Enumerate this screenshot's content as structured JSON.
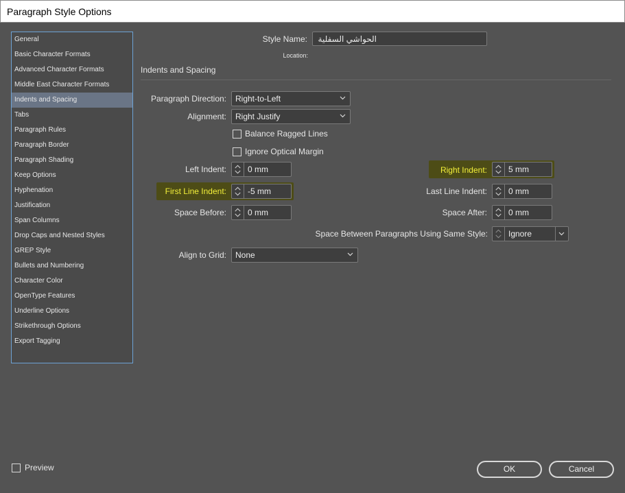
{
  "window": {
    "title": "Paragraph Style Options"
  },
  "sidebar": {
    "items": [
      {
        "label": "General"
      },
      {
        "label": "Basic Character Formats"
      },
      {
        "label": "Advanced Character Formats"
      },
      {
        "label": "Middle East Character Formats"
      },
      {
        "label": "Indents and Spacing",
        "selected": true
      },
      {
        "label": "Tabs"
      },
      {
        "label": "Paragraph Rules"
      },
      {
        "label": "Paragraph Border"
      },
      {
        "label": "Paragraph Shading"
      },
      {
        "label": "Keep Options"
      },
      {
        "label": "Hyphenation"
      },
      {
        "label": "Justification"
      },
      {
        "label": "Span Columns"
      },
      {
        "label": "Drop Caps and Nested Styles"
      },
      {
        "label": "GREP Style"
      },
      {
        "label": "Bullets and Numbering"
      },
      {
        "label": "Character Color"
      },
      {
        "label": "OpenType Features"
      },
      {
        "label": "Underline Options"
      },
      {
        "label": "Strikethrough Options"
      },
      {
        "label": "Export Tagging"
      }
    ]
  },
  "header": {
    "style_name_label": "Style Name:",
    "style_name_value": "الحواشي السفلية",
    "location_label": "Location:"
  },
  "section": {
    "title": "Indents and Spacing"
  },
  "form": {
    "paragraph_direction": {
      "label": "Paragraph Direction:",
      "value": "Right-to-Left"
    },
    "alignment": {
      "label": "Alignment:",
      "value": "Right Justify"
    },
    "balance_ragged_lines": {
      "label": "Balance Ragged Lines",
      "checked": false
    },
    "ignore_optical_margin": {
      "label": "Ignore Optical Margin",
      "checked": false
    },
    "left_indent": {
      "label": "Left Indent:",
      "value": "0 mm"
    },
    "right_indent": {
      "label": "Right Indent:",
      "value": "5 mm"
    },
    "first_line_indent": {
      "label": "First Line Indent:",
      "value": "-5 mm"
    },
    "last_line_indent": {
      "label": "Last Line Indent:",
      "value": "0 mm"
    },
    "space_before": {
      "label": "Space Before:",
      "value": "0 mm"
    },
    "space_after": {
      "label": "Space After:",
      "value": "0 mm"
    },
    "space_between": {
      "label": "Space Between Paragraphs Using Same Style:",
      "value": "Ignore"
    },
    "align_to_grid": {
      "label": "Align to Grid:",
      "value": "None"
    }
  },
  "footer": {
    "preview_label": "Preview",
    "preview_checked": false,
    "ok_label": "OK",
    "cancel_label": "Cancel"
  },
  "colors": {
    "background": "#535353",
    "highlight_text": "#f3f03a",
    "highlight_bg": "#4d4c16",
    "selection": "#6a7586",
    "sidebar_border": "#6da3d6"
  }
}
